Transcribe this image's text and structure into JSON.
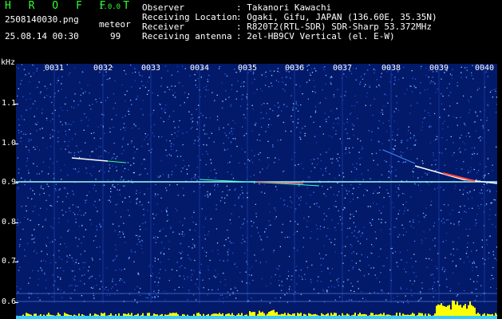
{
  "header": {
    "brand": "H R O F F T",
    "version": "1.0.0",
    "filename": "2508140030.png",
    "meteor_label": "meteor",
    "datetime": "25.08.14 00:30",
    "meteor_count": "99"
  },
  "info": [
    {
      "key": "Observer",
      "value": ": Takanori Kawachi"
    },
    {
      "key": "Receiving Location",
      "value": ": Ogaki, Gifu, JAPAN (136.60E, 35.35N)"
    },
    {
      "key": "Receiver",
      "value": ": R820T2(RTL-SDR) SDR-Sharp 53.372MHz"
    },
    {
      "key": "Receiving antenna",
      "value": ": 2el-HB9CV Vertical (el. E-W)"
    }
  ],
  "axis": {
    "unit": "kHz",
    "y_labels": [
      "1.1",
      "1.0",
      "0.9",
      "0.8",
      "0.7",
      "0.6"
    ],
    "time_labels": [
      "0031",
      "0032",
      "0033",
      "0034",
      "0035",
      "0036",
      "0037",
      "0038",
      "0039",
      "0040"
    ]
  },
  "colors": {
    "background": "#031a6b",
    "carrier": "#a0fff0",
    "meteor": "#ffffff",
    "overlay": "#ffff00"
  }
}
